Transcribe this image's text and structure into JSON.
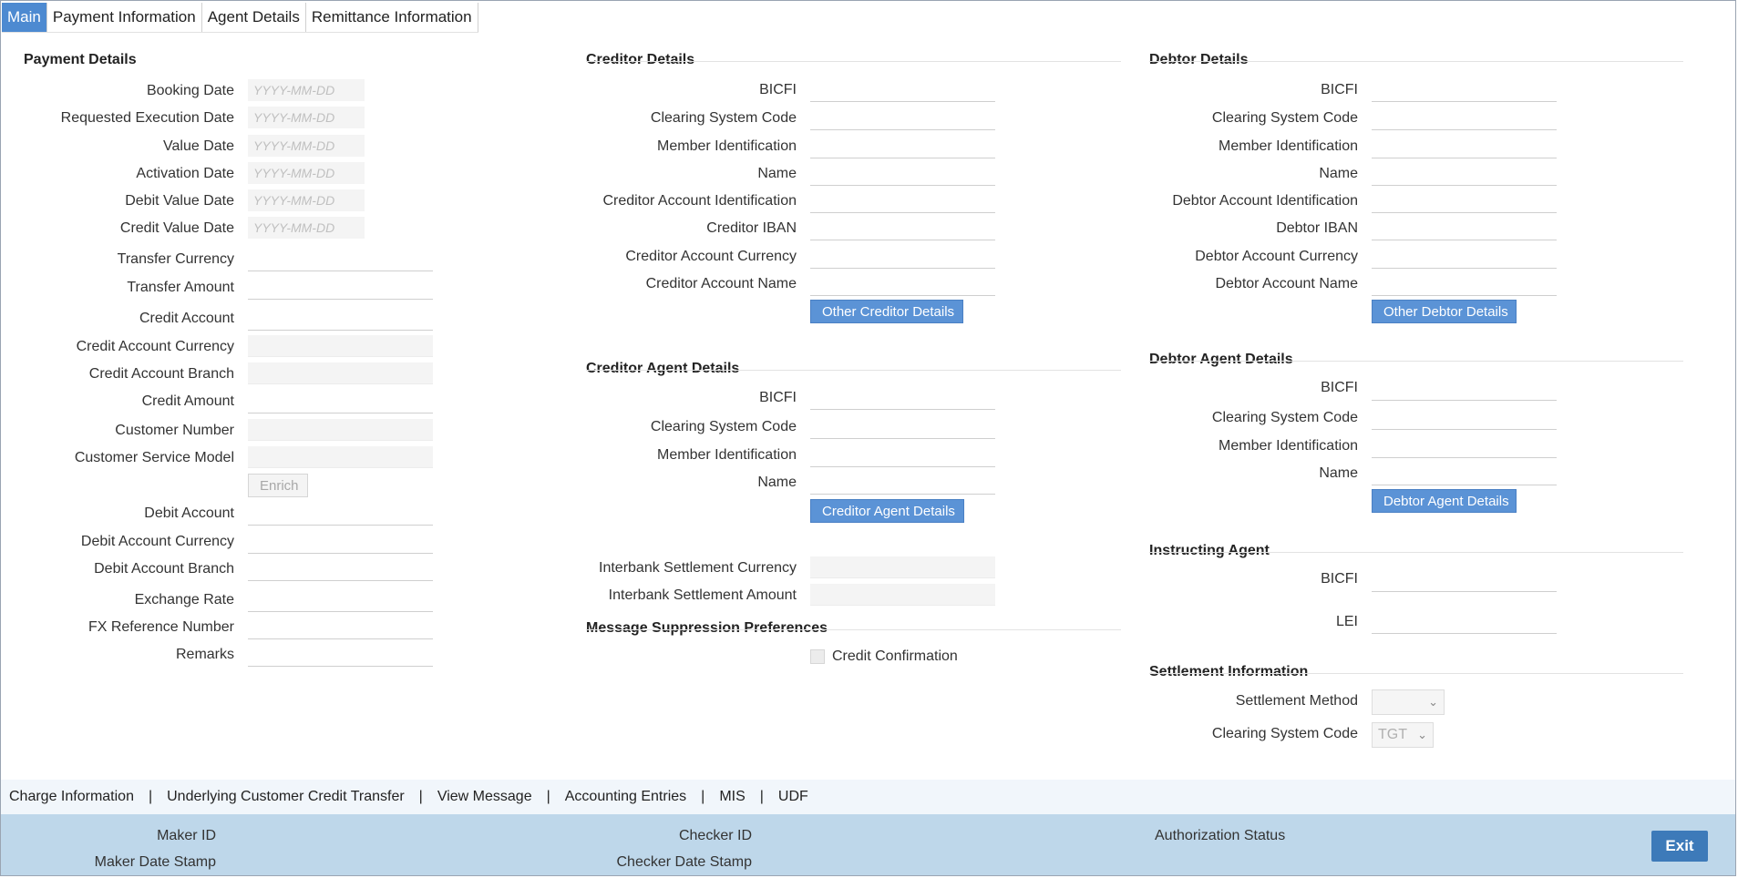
{
  "tabs": [
    "Main",
    "Payment Information",
    "Agent Details",
    "Remittance Information"
  ],
  "payment_details": {
    "title": "Payment Details",
    "date_placeholder": "YYYY-MM-DD",
    "booking_date": "Booking Date",
    "requested_execution_date": "Requested Execution Date",
    "value_date": "Value Date",
    "activation_date": "Activation Date",
    "debit_value_date": "Debit Value Date",
    "credit_value_date": "Credit Value Date",
    "transfer_currency": "Transfer Currency",
    "transfer_amount": "Transfer Amount",
    "credit_account": "Credit Account",
    "credit_account_currency": "Credit Account Currency",
    "credit_account_branch": "Credit Account Branch",
    "credit_amount": "Credit Amount",
    "customer_number": "Customer Number",
    "customer_service_model": "Customer Service Model",
    "enrich_button": "Enrich",
    "debit_account": "Debit Account",
    "debit_account_currency": "Debit Account Currency",
    "debit_account_branch": "Debit Account Branch",
    "exchange_rate": "Exchange Rate",
    "fx_reference_number": "FX Reference Number",
    "remarks": "Remarks"
  },
  "creditor_details": {
    "title": "Creditor Details",
    "bicfi": "BICFI",
    "clearing_system_code": "Clearing System Code",
    "member_identification": "Member Identification",
    "name": "Name",
    "account_identification": "Creditor Account Identification",
    "iban": "Creditor IBAN",
    "account_currency": "Creditor Account Currency",
    "account_name": "Creditor Account Name",
    "other_button": "Other Creditor Details"
  },
  "creditor_agent": {
    "title": "Creditor Agent Details",
    "bicfi": "BICFI",
    "clearing_system_code": "Clearing System Code",
    "member_identification": "Member Identification",
    "name": "Name",
    "button": "Creditor Agent Details"
  },
  "interbank": {
    "settlement_currency": "Interbank Settlement Currency",
    "settlement_amount": "Interbank Settlement Amount"
  },
  "message_suppression": {
    "title": "Message Suppression Preferences",
    "credit_confirmation": "Credit Confirmation"
  },
  "debtor_details": {
    "title": "Debtor Details",
    "bicfi": "BICFI",
    "clearing_system_code": "Clearing System Code",
    "member_identification": "Member Identification",
    "name": "Name",
    "account_identification": "Debtor Account Identification",
    "iban": "Debtor IBAN",
    "account_currency": "Debtor Account Currency",
    "account_name": "Debtor Account Name",
    "other_button": "Other Debtor Details"
  },
  "debtor_agent": {
    "title": "Debtor Agent Details",
    "bicfi": "BICFI",
    "clearing_system_code": "Clearing System Code",
    "member_identification": "Member Identification",
    "name": "Name",
    "button": "Debtor Agent Details"
  },
  "instructing_agent": {
    "title": "Instructing Agent",
    "bicfi": "BICFI",
    "lei": "LEI"
  },
  "settlement_info": {
    "title": "Settlement Information",
    "settlement_method": "Settlement Method",
    "settlement_method_value": "",
    "clearing_system_code": "Clearing System Code",
    "clearing_system_code_value": "TGT"
  },
  "bottom_links": [
    "Charge Information",
    "Underlying Customer Credit Transfer",
    "View Message",
    "Accounting Entries",
    "MIS",
    "UDF"
  ],
  "audit": {
    "maker_id": "Maker ID",
    "maker_date_stamp": "Maker Date Stamp",
    "checker_id": "Checker ID",
    "checker_date_stamp": "Checker Date Stamp",
    "authorization_status": "Authorization Status",
    "exit_button": "Exit"
  },
  "colors": {
    "tab_active": "#4d8ad1",
    "button": "#5b93d6",
    "audit_bar": "#bed7ea",
    "exit_button": "#3d7ab9"
  }
}
